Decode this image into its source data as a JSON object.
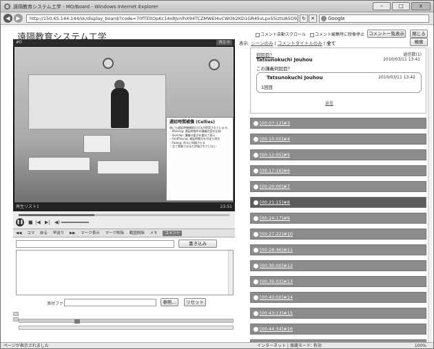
{
  "window": {
    "title": "遠隔教育システム工学 - MO/Board - Windows Internet Explorer",
    "minimize": "–",
    "maximize": "□",
    "close": "x"
  },
  "address": {
    "url": "http://150.65.144.144/sk/display_board/?code=70fTEltOpKc14x8JvnlhX94TCZMWEI4vCWOb2KD1GR45vLpx55iztUA5D9Z%2B",
    "search_label": "Google",
    "back": "◀",
    "forward": "▶"
  },
  "app": {
    "title": "遠隔教育システム工学"
  },
  "video": {
    "label": "#0",
    "status": "0:00:00",
    "right_badge": "再生中",
    "bottom_left": "再生リスト1",
    "time": "23:51",
    "slide_title": "遅延時間補償 (Cellies)",
    "slide_lines": [
      "他にも遅延時間補償の方法が提案されています。",
      "・Marking: 遅延時間中の講義内容を記録",
      "・Overlap: 講義の要点を重ねて表示",
      "・FastPlaying: 遅延時間分を早送り再生",
      "・Fading: 徐々に同期させる",
      "・全て実験ではまだ評価されていない"
    ]
  },
  "toolbar": {
    "items": [
      "◀◀",
      "コマ",
      "戻る",
      "早送り",
      "▶▶",
      "マーク表示",
      "マーク削除",
      "範囲削除",
      "メモ",
      "コメント"
    ]
  },
  "composer": {
    "submit_label": "書き込み",
    "file_label": "添付ファイル",
    "browse_label": "参照...",
    "reset_label": "リセット"
  },
  "right": {
    "auto_scroll_label": "コメント自動スクロール",
    "stop_label": "コメント編集時に映像停止",
    "list_button": "コメント一覧表示",
    "close_button": "閉じる",
    "search_button": "検索",
    "filter_prefix": "表示:",
    "filter_scene": "シーンのみ",
    "filter_title": "コメントタイトルのみ",
    "filter_all": "全て"
  },
  "comments": {
    "post": {
      "title": "何回目？",
      "count": "返信数(1)",
      "author": "Tatsunokuchi Jouhou",
      "date": "2010/03/11 13:41",
      "body": "この講義何回目？",
      "reply_link": "返信"
    },
    "reply": {
      "author": "Tatsunokuchi Jouhou",
      "date": "2010/03/11 13:42",
      "body": "1回目"
    },
    "bars": [
      {
        "time": "00:07:12",
        "num": "#3"
      },
      {
        "time": "00:10:00",
        "num": "#4"
      },
      {
        "time": "00:12:05",
        "num": "#5"
      },
      {
        "time": "00:17:16",
        "num": "#6"
      },
      {
        "time": "00:20:00",
        "num": "#7"
      },
      {
        "time": "00:21:15",
        "num": "#8"
      },
      {
        "time": "00:24:17",
        "num": "#9"
      },
      {
        "time": "00:27:22",
        "num": "#10"
      },
      {
        "time": "00:28:46",
        "num": "#11"
      },
      {
        "time": "00:30:00",
        "num": "#12"
      },
      {
        "time": "00:35:03",
        "num": "#13"
      },
      {
        "time": "00:40:00",
        "num": "#14"
      },
      {
        "time": "00:43:13",
        "num": "#15"
      },
      {
        "time": "00:44:34",
        "num": "#16"
      },
      {
        "time": "00:50:00",
        "num": "#17"
      },
      {
        "time": "00:51:40",
        "num": "#18"
      }
    ]
  },
  "statusbar": {
    "left": "ページが表示されました",
    "middle": "インターネット | 保護モード: 有効",
    "zoom": "100%"
  }
}
